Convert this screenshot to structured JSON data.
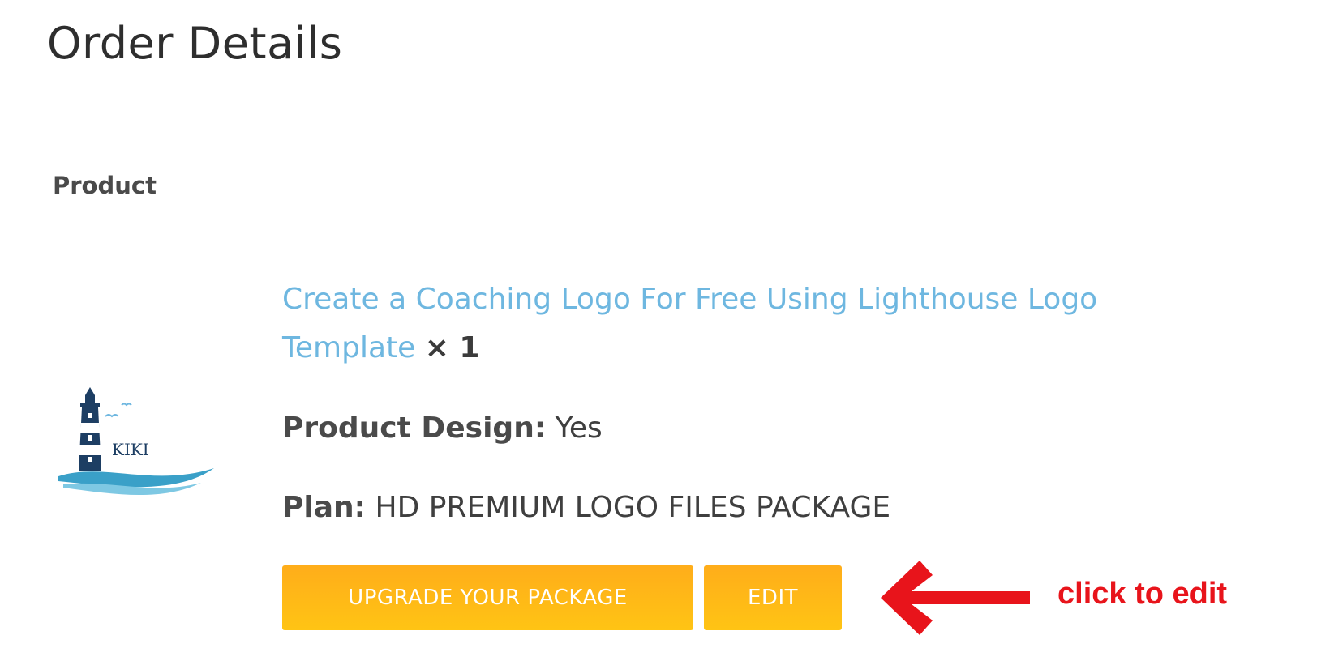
{
  "page": {
    "title": "Order Details"
  },
  "order": {
    "column_header": "Product",
    "product": {
      "name": "Create a Coaching Logo For Free Using Lighthouse Logo Template",
      "quantity_text": "× 1",
      "thumbnail_icon": "lighthouse-logo",
      "thumbnail_text": "KIKI",
      "link_color": "#6eb7e0"
    },
    "meta": [
      {
        "label": "Product Design:",
        "value": "Yes"
      },
      {
        "label": "Plan:",
        "value": "HD PREMIUM LOGO FILES PACKAGE"
      }
    ],
    "buttons": {
      "upgrade_label": "UPGRADE YOUR PACKAGE",
      "edit_label": "EDIT",
      "button_color": "#ffb719"
    }
  },
  "annotation": {
    "arrow_icon": "arrow-left-icon",
    "text": "click to edit",
    "color": "#e8141b"
  }
}
